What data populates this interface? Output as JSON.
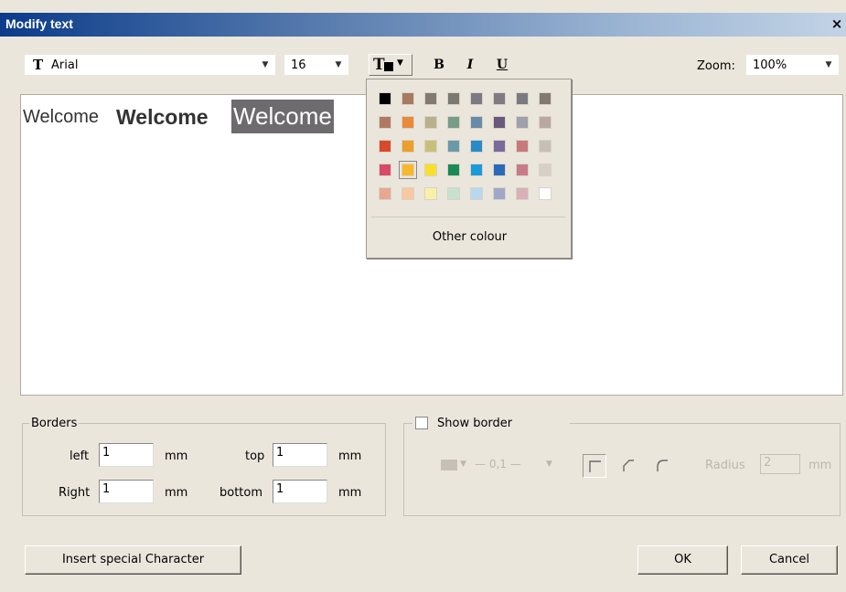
{
  "window": {
    "title": "Modify text",
    "close_glyph": "×"
  },
  "toolbar": {
    "font_icon_glyph": "T",
    "font_name": "Arial",
    "font_size": "16",
    "bold_glyph": "B",
    "italic_glyph": "I",
    "underline_glyph": "U",
    "zoom_label": "Zoom:",
    "zoom_value": "100%"
  },
  "editor": {
    "word1": "Welcome",
    "word2": "Welcome",
    "word3": "Welcome"
  },
  "palette": {
    "other_label": "Other colour",
    "colors": [
      [
        "#000000",
        "#a77a62",
        "#827a72",
        "#7a7a72",
        "#7a7a80",
        "#827a82",
        "#7a7a80",
        "#827a72"
      ],
      [
        "#b07a62",
        "#e88a3a",
        "#b8b08a",
        "#7a9a8a",
        "#6a8aaa",
        "#6a5a7a",
        "#a0a0aa",
        "#b8a8a0"
      ],
      [
        "#d84a2a",
        "#eaa02a",
        "#c8c07a",
        "#6a9aaa",
        "#2a8ac8",
        "#7a6a9a",
        "#c87a7a",
        "#c8c0b8"
      ],
      [
        "#d84a6a",
        "#f8b82a",
        "#f8e02a",
        "#1a8a5a",
        "#1a9ad8",
        "#2a6ab8",
        "#c87a8a",
        "#d8d0c8"
      ],
      [
        "#e8a890",
        "#f8c8a0",
        "#f8f0a8",
        "#c8e0d0",
        "#b8d8f0",
        "#a0a8c8",
        "#d8b0b8",
        "#ffffff"
      ]
    ]
  },
  "borders": {
    "group_label": "Borders",
    "left_label": "left",
    "left_value": "1",
    "top_label": "top",
    "top_value": "1",
    "right_label": "Right",
    "right_value": "1",
    "bottom_label": "bottom",
    "bottom_value": "1",
    "unit": "mm"
  },
  "show_border": {
    "label": "Show border",
    "line_width": "— 0,1 —",
    "radius_label": "Radius",
    "radius_value": "2",
    "unit": "mm"
  },
  "footer": {
    "insert_special": "Insert special Character",
    "ok": "OK",
    "cancel": "Cancel"
  }
}
